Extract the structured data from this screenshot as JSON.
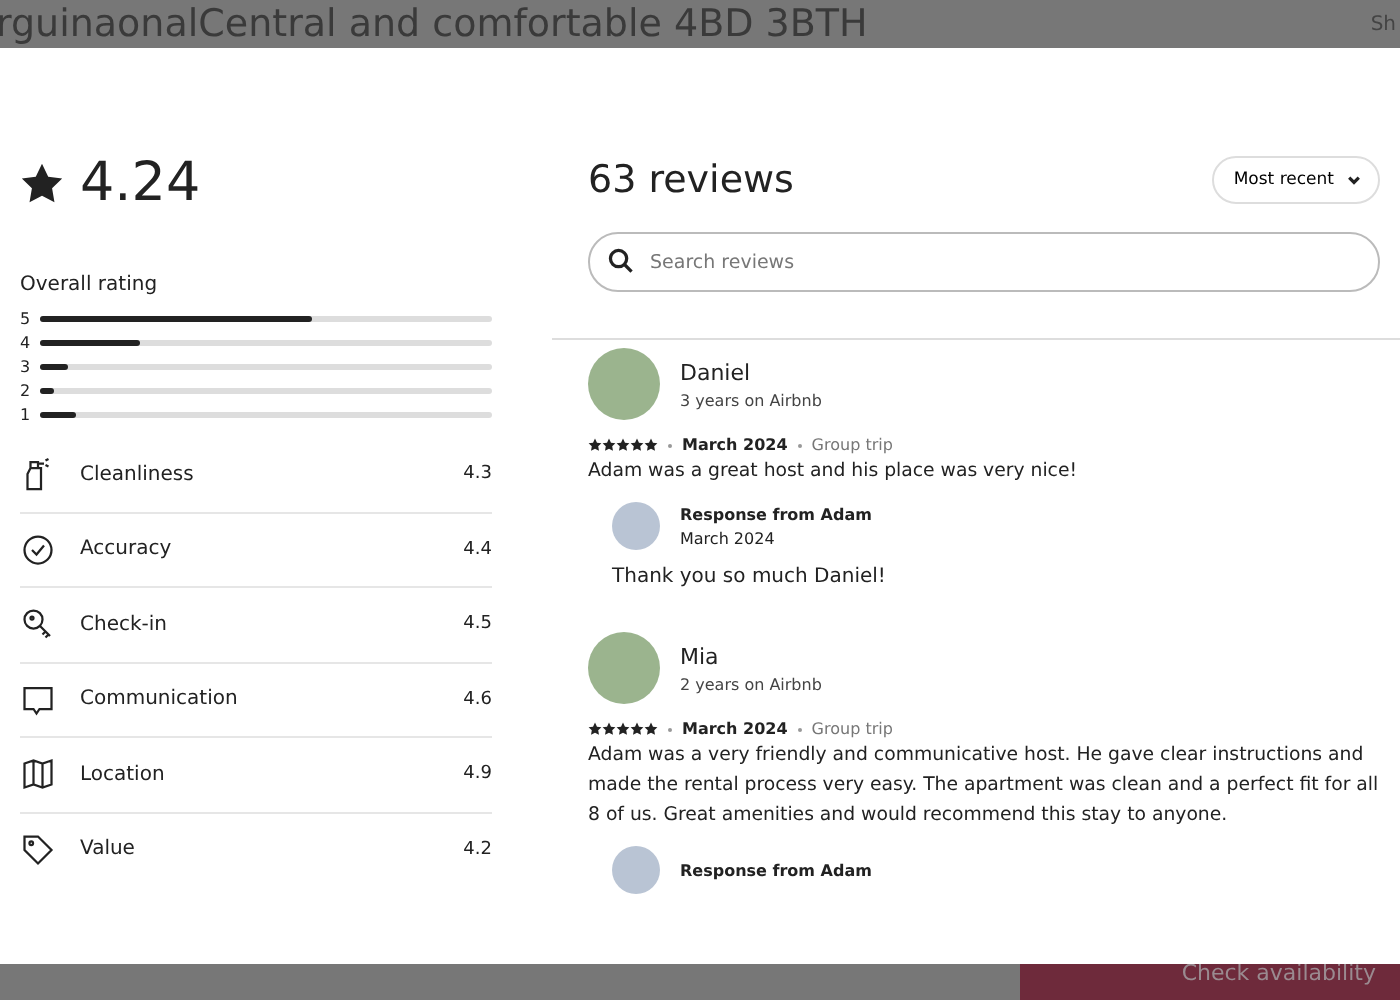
{
  "background_page": {
    "title": "rguinaonalCentral and comfortable 4BD 3BTH",
    "share_link": "Sh",
    "check_availability_button": "Check availability"
  },
  "summary": {
    "overall_score": "4.24",
    "overall_rating_label": "Overall rating",
    "distribution": [
      {
        "label": "5",
        "level": 0.6
      },
      {
        "label": "4",
        "level": 0.22
      },
      {
        "label": "3",
        "level": 0.06
      },
      {
        "label": "2",
        "level": 0.03
      },
      {
        "label": "1",
        "level": 0.08
      }
    ],
    "categories": [
      {
        "kind": "spray",
        "label": "Cleanliness",
        "score": "4.3"
      },
      {
        "kind": "check",
        "label": "Accuracy",
        "score": "4.4"
      },
      {
        "kind": "key",
        "label": "Check-in",
        "score": "4.5"
      },
      {
        "kind": "chat",
        "label": "Communication",
        "score": "4.6"
      },
      {
        "kind": "map",
        "label": "Location",
        "score": "4.9"
      },
      {
        "kind": "tag",
        "label": "Value",
        "score": "4.2"
      }
    ]
  },
  "reviews_panel": {
    "title": "63 reviews",
    "sort": "Most recent",
    "search": {
      "placeholder": "Search reviews"
    },
    "reviews": [
      {
        "name": "Daniel",
        "tenure": "3 years on Airbnb",
        "stars": 5,
        "date": "March 2024",
        "trip": "Group trip",
        "text": "Adam was a great host and his place was very nice!",
        "response": {
          "title": "Response from Adam",
          "date": "March 2024",
          "text": "Thank you so much Daniel!"
        }
      },
      {
        "name": "Mia",
        "tenure": "2 years on Airbnb",
        "stars": 5,
        "date": "March 2024",
        "trip": "Group trip",
        "text": "Adam was a very friendly and communicative host. He gave clear instructions and made the rental process very easy. The apartment was clean and a perfect fit for all 8 of us. Great amenities and would recommend this stay to anyone.",
        "response": {
          "title": "Response from Adam"
        }
      }
    ]
  }
}
